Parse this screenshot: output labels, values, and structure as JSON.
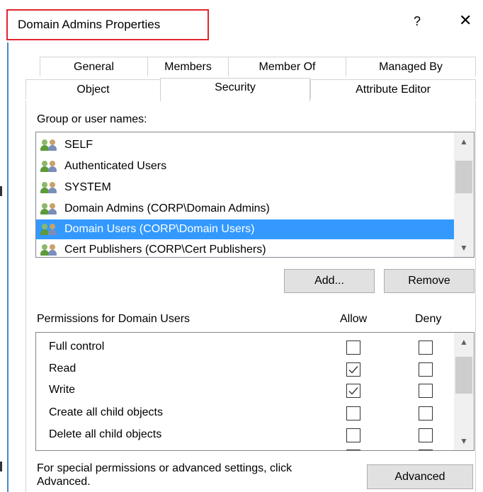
{
  "window": {
    "title": "Domain Admins Properties",
    "help_label": "?",
    "close_label": "✕"
  },
  "tabs": {
    "row1": [
      "General",
      "Members",
      "Member Of",
      "Managed By"
    ],
    "row2": [
      "Object",
      "Security",
      "Attribute Editor"
    ],
    "selected": "Security"
  },
  "groups": {
    "label": "Group or user names:",
    "items": [
      "SELF",
      "Authenticated Users",
      "SYSTEM",
      "Domain Admins (CORP\\Domain Admins)",
      "Domain Users (CORP\\Domain Users)",
      "Cert Publishers (CORP\\Cert Publishers)"
    ],
    "selected_index": 4
  },
  "buttons": {
    "add": "Add...",
    "remove": "Remove",
    "advanced": "Advanced"
  },
  "permissions": {
    "label": "Permissions for Domain Users",
    "allow_header": "Allow",
    "deny_header": "Deny",
    "rows": [
      {
        "name": "Full control",
        "allow": false,
        "deny": false
      },
      {
        "name": "Read",
        "allow": true,
        "deny": false
      },
      {
        "name": "Write",
        "allow": true,
        "deny": false
      },
      {
        "name": "Create all child objects",
        "allow": false,
        "deny": false
      },
      {
        "name": "Delete all child objects",
        "allow": false,
        "deny": false
      }
    ]
  },
  "footer": {
    "text": "For special permissions or advanced settings, click Advanced."
  },
  "colors": {
    "selection": "#3399ff",
    "title_highlight": "#e0262d"
  },
  "icons": {
    "group": "user-group-icon",
    "check": "checkmark-icon",
    "scroll_up": "chevron-up-icon",
    "scroll_down": "chevron-down-icon"
  }
}
